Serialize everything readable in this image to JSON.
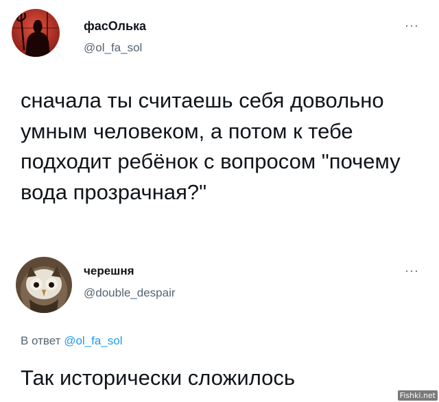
{
  "tweet": {
    "author_name": "фасОлька",
    "author_handle": "@ol_fa_sol",
    "avatar_icon": "devil-silhouette-avatar",
    "more_label": "···",
    "text": "сначала ты считаешь себя довольно умным человеком, а потом к тебе подходит ребёнок с вопросом \"почему вода прозрачная?\""
  },
  "reply": {
    "author_name": "черешня",
    "author_handle": "@double_despair",
    "avatar_icon": "owl-avatar",
    "more_label": "···",
    "reply_to_prefix": "В ответ",
    "reply_to_handle": "@ol_fa_sol",
    "text": "Так исторически сложилось"
  },
  "watermark": "Fishki.net",
  "colors": {
    "text": "#0f1419",
    "secondary": "#536471",
    "link": "#1d9bf0",
    "avatar1_bg": "#b3342a"
  }
}
